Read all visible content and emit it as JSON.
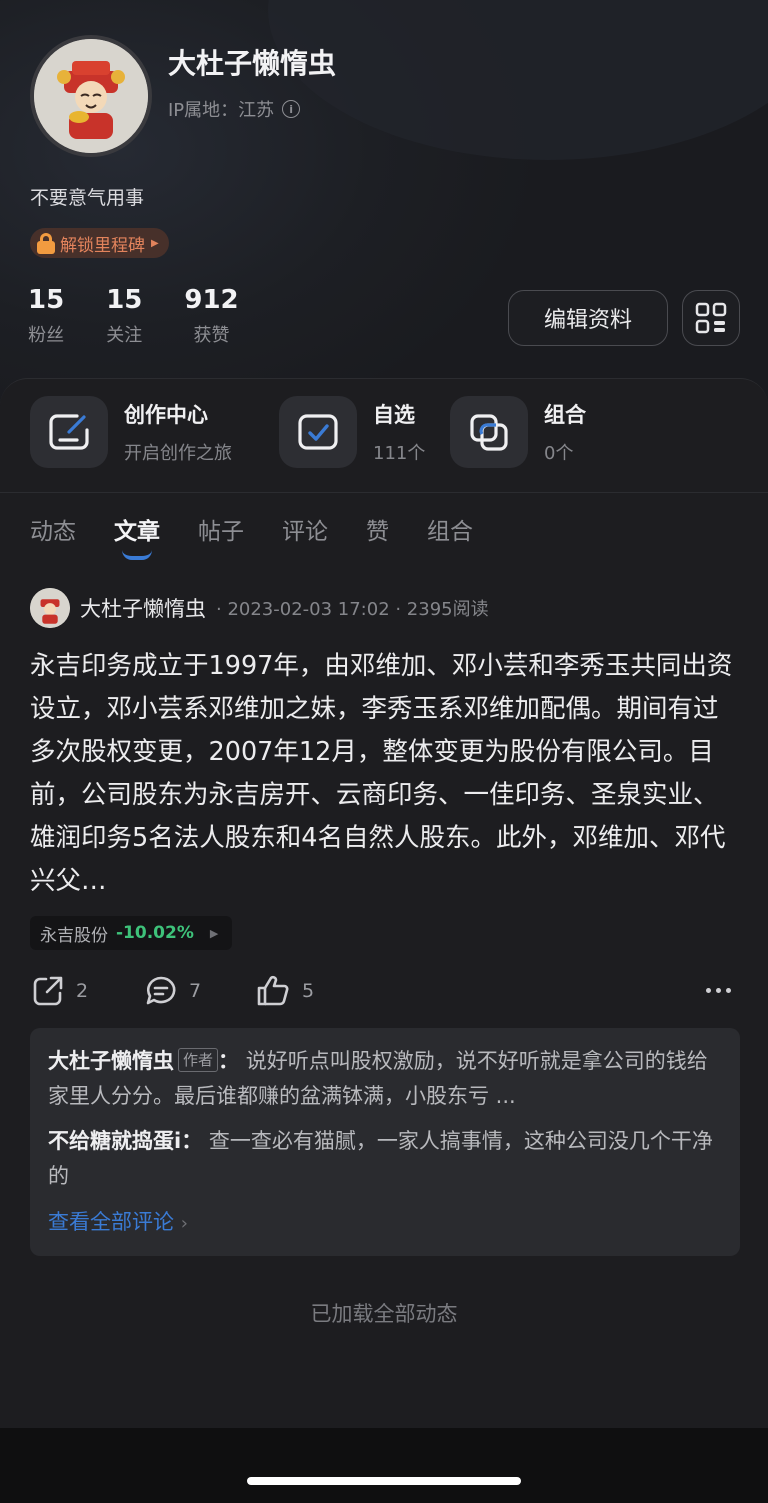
{
  "profile": {
    "name": "大杜子懒惰虫",
    "ip_location": "IP属地：江苏",
    "bio": "不要意气用事",
    "milestone": "解锁里程碑"
  },
  "stats": [
    {
      "value": "15",
      "label": "粉丝"
    },
    {
      "value": "15",
      "label": "关注"
    },
    {
      "value": "912",
      "label": "获赞"
    }
  ],
  "edit_profile_label": "编辑资料",
  "quick_links": [
    {
      "title": "创作中心",
      "subtitle": "开启创作之旅"
    },
    {
      "title": "自选",
      "subtitle": "111个"
    },
    {
      "title": "组合",
      "subtitle": "0个"
    }
  ],
  "tabs": [
    "动态",
    "文章",
    "帖子",
    "评论",
    "赞",
    "组合"
  ],
  "active_tab": "文章",
  "post": {
    "author": "大杜子懒惰虫",
    "meta": "· 2023-02-03 17:02 · 2395阅读",
    "body": "永吉印务成立于1997年，由邓维加、邓小芸和李秀玉共同出资设立，邓小芸系邓维加之妹，李秀玉系邓维加配偶。期间有过多次股权变更，2007年12月，整体变更为股份有限公司。目前，公司股东为永吉房开、云商印务、一佳印务、圣泉实业、雄润印务5名法人股东和4名自然人股东。此外，邓维加、邓代兴父…",
    "stock_name": "永吉股份",
    "stock_change": "-10.02%",
    "shares": "2",
    "comments": "7",
    "likes": "5"
  },
  "comment_preview": [
    {
      "name": "大杜子懒惰虫",
      "tag": "作者",
      "text": "说好听点叫股权激励，说不好听就是拿公司的钱给家里人分分。最后谁都赚的盆满钵满，小股东亏 ..."
    },
    {
      "name": "不给糖就捣蛋i",
      "text": "查一查必有猫腻，一家人搞事情，这种公司没几个干净的"
    }
  ],
  "view_all_comments": "查看全部评论",
  "end_note": "已加载全部动态",
  "colors": {
    "accent": "#3a7bd5",
    "down": "#3ec27a",
    "milestone": "#e2835c"
  }
}
